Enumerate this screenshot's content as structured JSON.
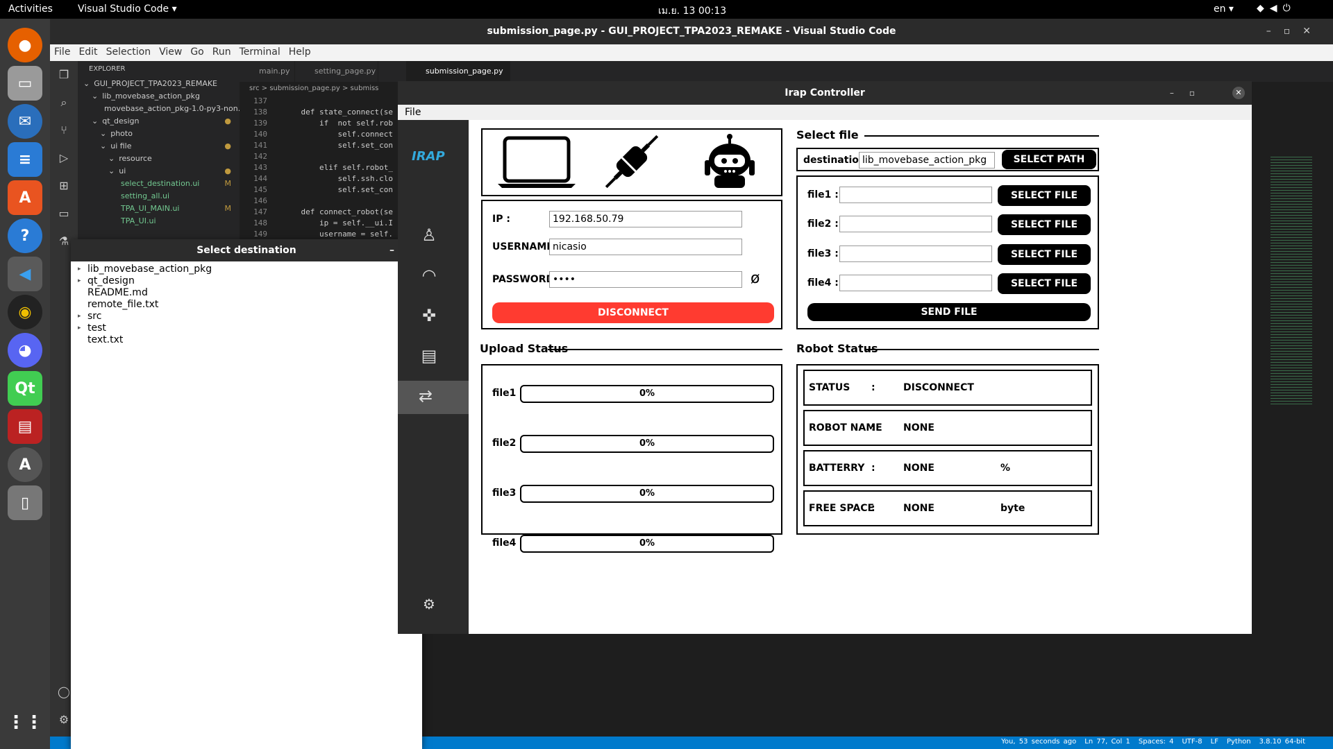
{
  "system": {
    "activities": "Activities",
    "app_name": "Visual Studio Code ▾",
    "clock": "เม.ย. 13  00:13",
    "lang": "en ▾"
  },
  "vscode": {
    "title": "submission_page.py - GUI_PROJECT_TPA2023_REMAKE - Visual Studio Code",
    "menu": [
      "File",
      "Edit",
      "Selection",
      "View",
      "Go",
      "Run",
      "Terminal",
      "Help"
    ],
    "explorer_header": "EXPLORER",
    "tree": [
      {
        "label": "GUI_PROJECT_TPA2023_REMAKE",
        "indent": 0,
        "mark": ""
      },
      {
        "label": "lib_movebase_action_pkg",
        "indent": 1,
        "mark": ""
      },
      {
        "label": "movebase_action_pkg-1.0-py3-non...",
        "indent": 2,
        "mark": ""
      },
      {
        "label": "qt_design",
        "indent": 1,
        "mark": "●"
      },
      {
        "label": "photo",
        "indent": 2,
        "mark": ""
      },
      {
        "label": "ui file",
        "indent": 2,
        "mark": "●"
      },
      {
        "label": "resource",
        "indent": 3,
        "mark": ""
      },
      {
        "label": "ui",
        "indent": 3,
        "mark": "●"
      },
      {
        "label": "select_destination.ui",
        "indent": 4,
        "mark": "M"
      },
      {
        "label": "setting_all.ui",
        "indent": 4,
        "mark": ""
      },
      {
        "label": "TPA_UI_MAIN.ui",
        "indent": 4,
        "mark": "M"
      },
      {
        "label": "TPA_UI.ui",
        "indent": 4,
        "mark": ""
      }
    ],
    "tabs": [
      "main.py",
      "setting_page.py",
      "submission_page.py M"
    ],
    "breadcrumb": "src > submission_page.py > submiss",
    "code": [
      {
        "n": "137",
        "t": ""
      },
      {
        "n": "138",
        "t": "    def state_connect(se"
      },
      {
        "n": "139",
        "t": "        if  not self.rob"
      },
      {
        "n": "140",
        "t": "            self.connect"
      },
      {
        "n": "141",
        "t": "            self.set_con"
      },
      {
        "n": "142",
        "t": ""
      },
      {
        "n": "143",
        "t": "        elif self.robot_"
      },
      {
        "n": "144",
        "t": "            self.ssh.clo"
      },
      {
        "n": "145",
        "t": "            self.set_con"
      },
      {
        "n": "146",
        "t": ""
      },
      {
        "n": "147",
        "t": "    def connect_robot(se"
      },
      {
        "n": "148",
        "t": "        ip = self.__ui.I"
      },
      {
        "n": "149",
        "t": "        username = self."
      }
    ],
    "status_items": [
      "You, 53 seconds ago",
      "Ln 77, Col 1",
      "Spaces: 4",
      "UTF-8",
      "LF",
      "Python",
      "3.8.10 64-bit"
    ]
  },
  "select_dialog": {
    "title": "Select destination",
    "items": [
      {
        "label": "lib_movebase_action_pkg",
        "arrow": "▸"
      },
      {
        "label": "qt_design",
        "arrow": "▸"
      },
      {
        "label": "README.md",
        "arrow": ""
      },
      {
        "label": "remote_file.txt",
        "arrow": ""
      },
      {
        "label": "src",
        "arrow": "▸"
      },
      {
        "label": "test",
        "arrow": "▸"
      },
      {
        "label": "text.txt",
        "arrow": ""
      }
    ]
  },
  "irap": {
    "title": "Irap Controller",
    "menu_file": "File",
    "logo": "IRAP",
    "connection": {
      "ip_label": "IP  :",
      "ip_value": "192.168.50.79",
      "username_label": "USERNAME :",
      "username_value": "nicasio",
      "password_label": "PASSWORD :",
      "password_value": "••••",
      "disconnect_label": "DISCONNECT"
    },
    "select_file": {
      "heading": "Select file",
      "destination_label": "destination :",
      "destination_value": "lib_movebase_action_pkg",
      "select_path_label": "SELECT PATH",
      "files": [
        {
          "label": "file1 :",
          "value": "",
          "button": "SELECT FILE"
        },
        {
          "label": "file2 :",
          "value": "",
          "button": "SELECT FILE"
        },
        {
          "label": "file3 :",
          "value": "",
          "button": "SELECT FILE"
        },
        {
          "label": "file4 :",
          "value": "",
          "button": "SELECT FILE"
        }
      ],
      "send_label": "SEND FILE"
    },
    "upload_status": {
      "heading": "Upload Status",
      "rows": [
        {
          "label": "file1 :",
          "progress": "0%"
        },
        {
          "label": "file2 :",
          "progress": "0%"
        },
        {
          "label": "file3 :",
          "progress": "0%"
        },
        {
          "label": "file4 :",
          "progress": "0%"
        }
      ]
    },
    "robot_status": {
      "heading": "Robot Status",
      "rows": [
        {
          "key": "STATUS",
          "sep": ":",
          "value": "DISCONNECT",
          "unit": ""
        },
        {
          "key": "ROBOT NAME",
          "sep": ":",
          "value": "NONE",
          "unit": ""
        },
        {
          "key": "BATTERRY",
          "sep": ":",
          "value": "NONE",
          "unit": "%"
        },
        {
          "key": "FREE SPACE",
          "sep": ":",
          "value": "NONE",
          "unit": "byte"
        }
      ]
    }
  }
}
